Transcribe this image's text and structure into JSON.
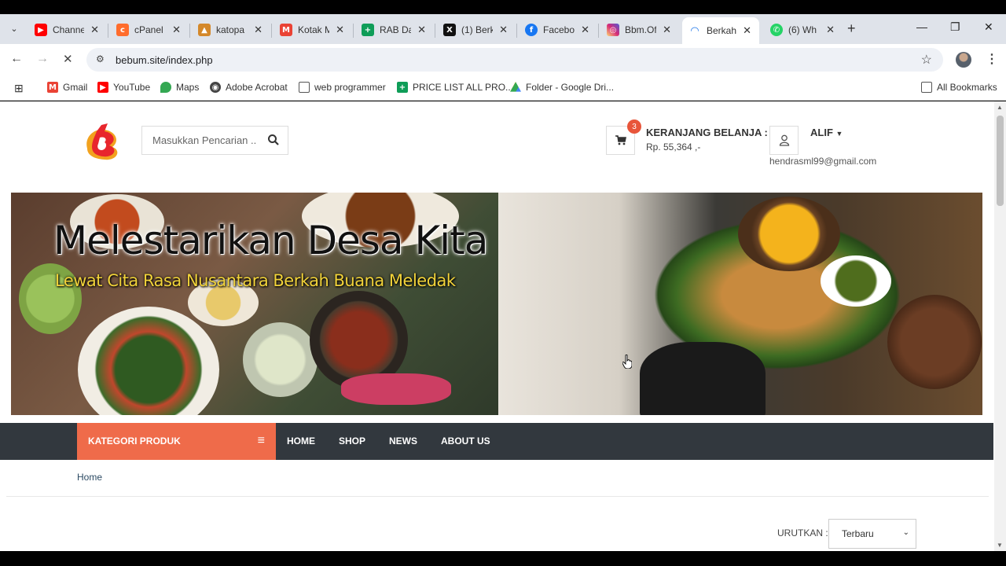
{
  "browser": {
    "tabs": [
      {
        "label": "Channe",
        "icon": "youtube-icon",
        "color": "#ff0000"
      },
      {
        "label": "cPanel",
        "icon": "cpanel-icon",
        "color": "#ff6c2c"
      },
      {
        "label": "katopa",
        "icon": "katopa-icon",
        "color": "#d4882a"
      },
      {
        "label": "Kotak M",
        "icon": "gmail-icon",
        "color": "#ea4335"
      },
      {
        "label": "RAB Da",
        "icon": "sheets-icon",
        "color": "#0f9d58"
      },
      {
        "label": "(1) Berk",
        "icon": "x-icon",
        "color": "#111111"
      },
      {
        "label": "Facebo",
        "icon": "facebook-icon",
        "color": "#1877f2"
      },
      {
        "label": "Bbm.Of",
        "icon": "instagram-icon",
        "color": "#d62976"
      },
      {
        "label": "Berkah",
        "icon": "loading-icon",
        "color": "#1a73e8"
      },
      {
        "label": "(6) Wh",
        "icon": "whatsapp-icon",
        "color": "#25d366"
      }
    ],
    "url": "bebum.site/index.php",
    "bookmarks": [
      {
        "label": "Gmail",
        "icon": "gmail-icon"
      },
      {
        "label": "YouTube",
        "icon": "youtube-icon"
      },
      {
        "label": "Maps",
        "icon": "maps-icon"
      },
      {
        "label": "Adobe Acrobat",
        "icon": "acrobat-icon"
      },
      {
        "label": "web programmer",
        "icon": "folder-icon"
      },
      {
        "label": "PRICE LIST ALL PRO...",
        "icon": "sheets-icon"
      },
      {
        "label": "Folder - Google Dri...",
        "icon": "drive-icon"
      }
    ],
    "all_bookmarks": "All Bookmarks"
  },
  "header": {
    "search_placeholder": "Masukkan Pencarian ..",
    "cart_count": "3",
    "cart_title": "KERANJANG BELANJA :",
    "cart_total": "Rp. 55,364 ,-",
    "user_name": "ALIF",
    "user_email": "hendrasml99@gmail.com"
  },
  "banner": {
    "title": "Melestarikan Desa Kita",
    "subtitle": "Lewat Cita Rasa Nusantara Berkah Buana Meledak"
  },
  "nav": {
    "category_label": "KATEGORI PRODUK",
    "items": [
      "HOME",
      "SHOP",
      "NEWS",
      "ABOUT US"
    ]
  },
  "breadcrumb": "Home",
  "sort": {
    "label": "URUTKAN :",
    "value": "Terbaru"
  },
  "colors": {
    "accent": "#ef6b4a",
    "navbar": "#32383e"
  }
}
